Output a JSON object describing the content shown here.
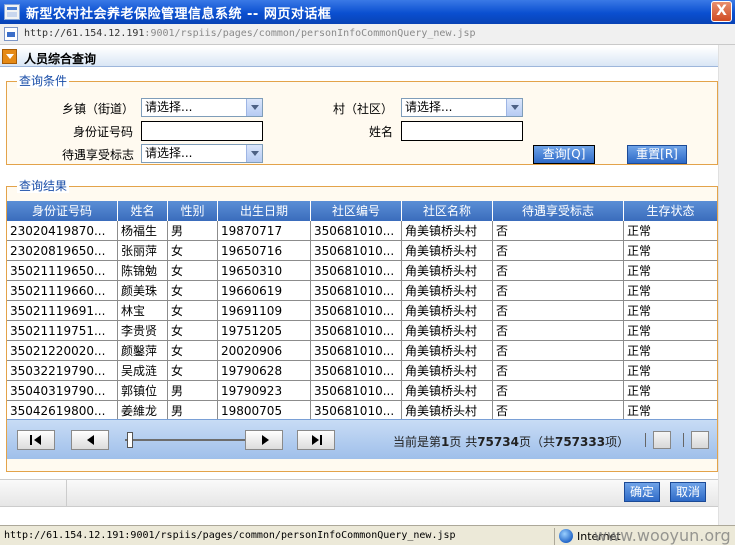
{
  "window": {
    "title": "新型农村社会养老保险管理信息系统 -- 网页对话框",
    "close_label": "X"
  },
  "address": {
    "host": "http://61.154.12.191",
    "path": ":9001/rspiis/pages/common/personInfoCommonQuery_new.jsp"
  },
  "page": {
    "title": "人员综合查询"
  },
  "conditions": {
    "legend": "查询条件",
    "town_label": "乡镇（街道）",
    "town_value": "请选择...",
    "village_label": "村（社区）",
    "village_value": "请选择...",
    "id_label": "身份证号码",
    "id_value": "",
    "name_label": "姓名",
    "name_value": "",
    "benefit_label": "待遇享受标志",
    "benefit_value": "请选择...",
    "query_button": "查询[Q]",
    "reset_button": "重置[R]"
  },
  "results": {
    "legend": "查询结果",
    "columns": [
      "身份证号码",
      "姓名",
      "性别",
      "出生日期",
      "社区编号",
      "社区名称",
      "待遇享受标志",
      "生存状态"
    ],
    "rows": [
      [
        "23020419870...",
        "杨福生",
        "男",
        "19870717",
        "350681010...",
        "角美镇桥头村",
        "否",
        "正常"
      ],
      [
        "23020819650...",
        "张丽萍",
        "女",
        "19650716",
        "350681010...",
        "角美镇桥头村",
        "否",
        "正常"
      ],
      [
        "35021119650...",
        "陈锦勉",
        "女",
        "19650310",
        "350681010...",
        "角美镇桥头村",
        "否",
        "正常"
      ],
      [
        "35021119660...",
        "颜美珠",
        "女",
        "19660619",
        "350681010...",
        "角美镇桥头村",
        "否",
        "正常"
      ],
      [
        "35021119691...",
        "林宝",
        "女",
        "19691109",
        "350681010...",
        "角美镇桥头村",
        "否",
        "正常"
      ],
      [
        "35021119751...",
        "李贵贤",
        "女",
        "19751205",
        "350681010...",
        "角美镇桥头村",
        "否",
        "正常"
      ],
      [
        "35021220020...",
        "颜鑿萍",
        "女",
        "20020906",
        "350681010...",
        "角美镇桥头村",
        "否",
        "正常"
      ],
      [
        "35032219790...",
        "吴成涟",
        "女",
        "19790628",
        "350681010...",
        "角美镇桥头村",
        "否",
        "正常"
      ],
      [
        "35040319790...",
        "郭镇位",
        "男",
        "19790923",
        "350681010...",
        "角美镇桥头村",
        "否",
        "正常"
      ],
      [
        "35042619800...",
        "姜維龙",
        "男",
        "19800705",
        "350681010...",
        "角美镇桥头村",
        "否",
        "正常"
      ]
    ]
  },
  "pager": {
    "p1": "当前是第",
    "current_page": "1",
    "p2": "页 共",
    "total_pages": "75734",
    "p3": "页（共",
    "total_items": "757333",
    "p4": "项）",
    "slider_position": 0
  },
  "footer": {
    "ok_button": "确定",
    "cancel_button": "取消"
  },
  "status": {
    "url": "http://61.154.12.191:9001/rspiis/pages/common/personInfoCommonQuery_new.jsp",
    "zone": "Internet",
    "watermark": "www.wooyun.org"
  },
  "colors": {
    "title_bar": "#0a4fd0",
    "table_header": "#4a7ec9",
    "fieldset_border": "#e3a34a",
    "legend_text": "#1a4ea8",
    "button": "#2e6ac7"
  }
}
